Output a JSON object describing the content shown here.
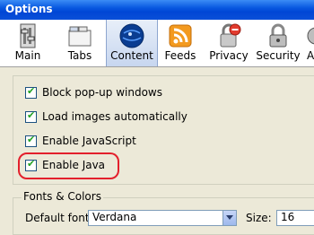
{
  "window": {
    "title": "Options"
  },
  "toolbar": {
    "items": [
      {
        "label": "Main",
        "icon": "switch-icon"
      },
      {
        "label": "Tabs",
        "icon": "tabs-icon"
      },
      {
        "label": "Content",
        "icon": "globe-icon",
        "selected": true
      },
      {
        "label": "Feeds",
        "icon": "rss-icon"
      },
      {
        "label": "Privacy",
        "icon": "lock-icon"
      },
      {
        "label": "Security",
        "icon": "padlock-icon"
      },
      {
        "label": "A",
        "icon": "advanced-icon"
      }
    ]
  },
  "content": {
    "options": [
      {
        "label": "Block pop-up windows",
        "checked": true
      },
      {
        "label": "Load images automatically",
        "checked": true
      },
      {
        "label": "Enable JavaScript",
        "checked": true
      },
      {
        "label": "Enable Java",
        "checked": true
      }
    ],
    "fonts": {
      "legend": "Fonts & Colors",
      "default_font_label": "Default font:",
      "default_font_value": "Verdana",
      "size_label": "Size:",
      "size_value": "16"
    }
  },
  "colors": {
    "highlight": "#e3202c",
    "titlebar": "#0858e0",
    "check": "#21a121"
  }
}
